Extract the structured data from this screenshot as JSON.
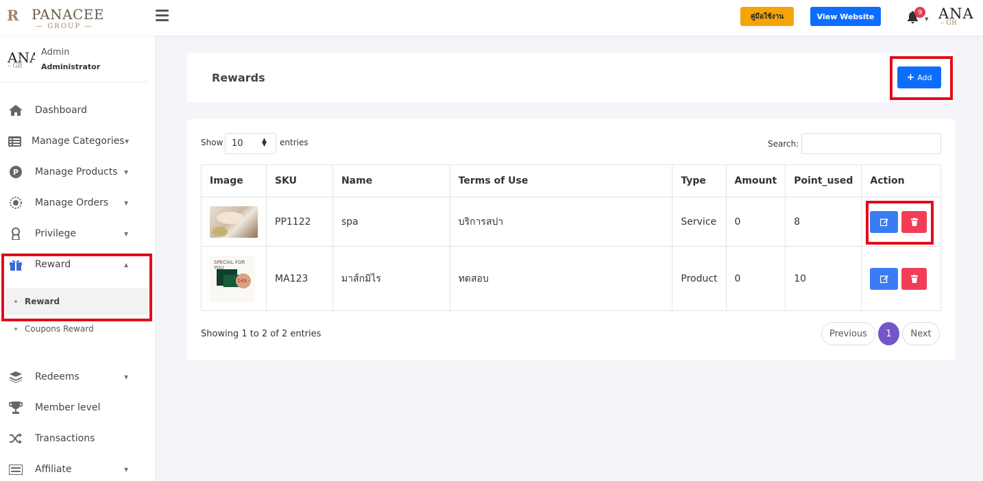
{
  "header": {
    "logo_monogram": "R",
    "logo_brand": "PANACEE",
    "logo_group": "GROUP",
    "manual_button": "คู่มือใช้งาน",
    "view_website_button": "View Website",
    "notification_count": "9",
    "avatar_text_top": "ANA",
    "avatar_text_bottom": "– GR"
  },
  "sidebar": {
    "user": {
      "avatar_top": "ANA",
      "avatar_bottom": "– GR",
      "role": "Admin",
      "name": "Administrator"
    },
    "items": [
      {
        "label": "Dashboard",
        "icon": "home-icon"
      },
      {
        "label": "Manage Categories",
        "icon": "list-icon"
      },
      {
        "label": "Manage Products",
        "icon": "product-icon"
      },
      {
        "label": "Manage Orders",
        "icon": "orders-icon"
      },
      {
        "label": "Privilege",
        "icon": "award-icon"
      },
      {
        "label": "Reward",
        "icon": "gift-icon"
      },
      {
        "label": "Redeems",
        "icon": "layers-icon"
      },
      {
        "label": "Member level",
        "icon": "trophy-icon"
      },
      {
        "label": "Transactions",
        "icon": "shuffle-icon"
      },
      {
        "label": "Affiliate",
        "icon": "card-icon"
      }
    ],
    "reward_subitems": [
      {
        "label": "Reward"
      },
      {
        "label": "Coupons Reward"
      }
    ]
  },
  "page": {
    "title": "Rewards",
    "add_button": "Add"
  },
  "table_controls": {
    "show_label": "Show",
    "entries_value": "10",
    "entries_label": "entries",
    "search_label": "Search:",
    "search_value": ""
  },
  "table": {
    "columns": [
      "Image",
      "SKU",
      "Name",
      "Terms of Use",
      "Type",
      "Amount",
      "Point_used",
      "Action"
    ],
    "rows": [
      {
        "sku": "PP1122",
        "name": "spa",
        "terms": "บริการสปา",
        "type": "Service",
        "amount": "0",
        "point_used": "8",
        "image_text": ""
      },
      {
        "sku": "MA123",
        "name": "มาส์กมิไร",
        "terms": "ทดสอบ",
        "type": "Product",
        "amount": "0",
        "point_used": "10",
        "image_text": "SPECIAL FOR YOU",
        "image_price": "149.-"
      }
    ]
  },
  "footer": {
    "info": "Showing 1 to 2 of 2 entries",
    "previous": "Previous",
    "current_page": "1",
    "next": "Next"
  },
  "colors": {
    "primary": "#0d6efd",
    "warning": "#f4a409",
    "danger": "#f23d57",
    "highlight": "#e40b1a",
    "pagination_active": "#7357c8"
  }
}
